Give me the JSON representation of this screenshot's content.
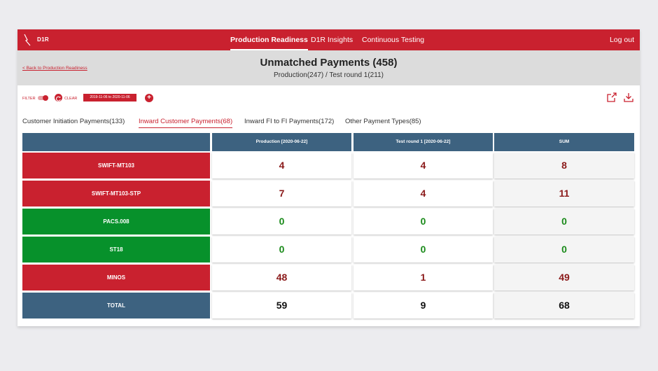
{
  "app": {
    "logo_text": "D1R"
  },
  "nav": {
    "items": [
      "Production Readiness",
      "D1R Insights",
      "Continuous Testing"
    ],
    "logout": "Log out"
  },
  "header": {
    "back_link": "< Back to Production Readiness",
    "title": "Unmatched Payments (458)",
    "subtitle": "Production(247) / Test round 1(211)"
  },
  "filters": {
    "filter_label": "FILTER",
    "clear_label": "CLEAR",
    "date_range": "2019-11-06  to  2020-11-06",
    "add_label": "+"
  },
  "tabs": [
    "Customer Initiation Payments(133)",
    "Inward Customer Payments(68)",
    "Inward FI to FI Payments(172)",
    "Other Payment Types(85)"
  ],
  "table": {
    "columns": [
      "Production [2020-06-22]",
      "Test round 1  [2020-06-22]",
      "SUM"
    ],
    "rows": [
      {
        "label": "SWIFT-MT103",
        "values": [
          "4",
          "4",
          "8"
        ]
      },
      {
        "label": "SWIFT-MT103-STP",
        "values": [
          "7",
          "4",
          "11"
        ]
      },
      {
        "label": "PACS.008",
        "values": [
          "0",
          "0",
          "0"
        ]
      },
      {
        "label": "ST18",
        "values": [
          "0",
          "0",
          "0"
        ]
      },
      {
        "label": "MINOS",
        "values": [
          "48",
          "1",
          "49"
        ]
      },
      {
        "label": "TOTAL",
        "values": [
          "59",
          "9",
          "68"
        ]
      }
    ]
  },
  "colors": {
    "brand_red": "#c9212f",
    "header_blue": "#3d6280",
    "ok_green": "#07912b",
    "value_red": "#8b1a1a",
    "value_green": "#1a8a1a"
  }
}
